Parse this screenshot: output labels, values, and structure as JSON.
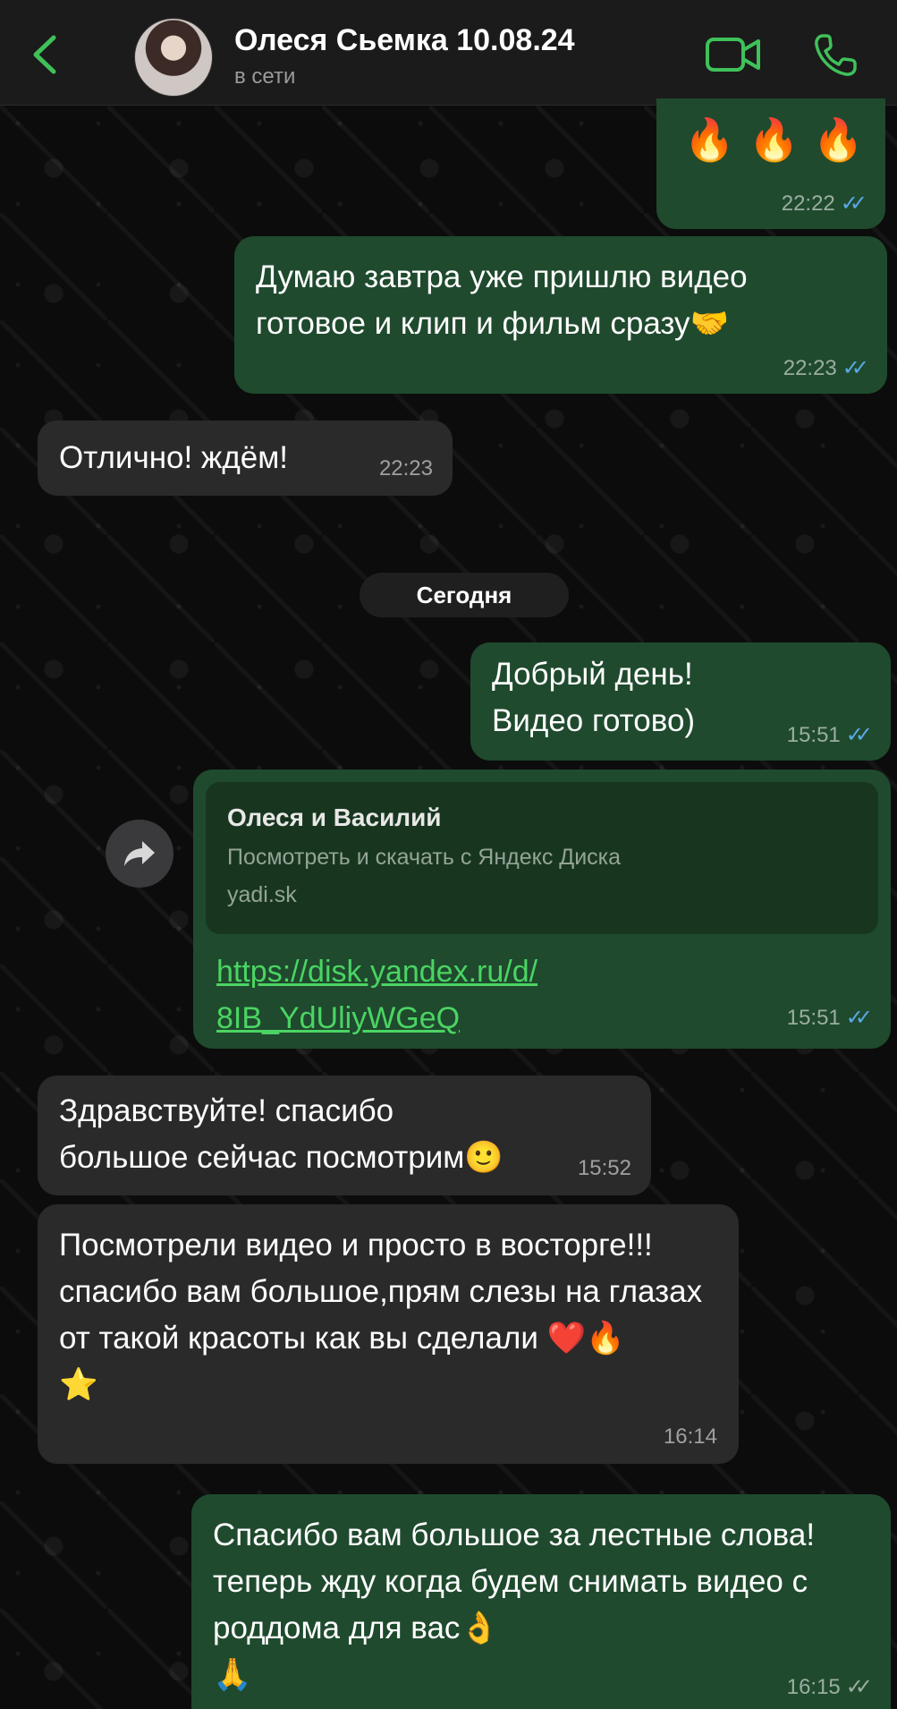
{
  "header": {
    "contact_name": "Олеся Сьемка 10.08.24",
    "status": "в сети",
    "accent": "#3fc15a"
  },
  "date_separator": "Сегодня",
  "messages": [
    {
      "dir": "out",
      "text": "🔥 🔥 🔥",
      "time": "22:22",
      "ticks": "read"
    },
    {
      "dir": "out",
      "text": "Думаю завтра уже пришлю видео готовое и клип и фильм сразу🤝",
      "time": "22:23",
      "ticks": "read"
    },
    {
      "dir": "in",
      "text": "Отлично! ждём!",
      "time": "22:23"
    },
    {
      "dir": "out",
      "text": "Добрый день!\nВидео готово)",
      "time": "15:51",
      "ticks": "read"
    },
    {
      "dir": "out",
      "link_title": "Олеся и Василий",
      "link_desc": "Посмотреть и скачать с Яндекс Диска",
      "link_domain": "yadi.sk",
      "link_url": "https://disk.yandex.ru/d/\n8IB_YdUliyWGeQ",
      "time": "15:51",
      "ticks": "read"
    },
    {
      "dir": "in",
      "text": "Здравствуйте! спасибо большое сейчас посмотрим🙂",
      "time": "15:52"
    },
    {
      "dir": "in",
      "text": "Посмотрели видео и просто в восторге!!!спасибо вам большое,прям слезы на глазах от такой красоты как вы сделали ❤️🔥\n⭐",
      "time": "16:14"
    },
    {
      "dir": "out",
      "text": "Спасибо вам большое за лестные слова!теперь жду когда будем снимать видео с роддома для вас👌\n🙏",
      "time": "16:15",
      "ticks": "delivered"
    }
  ],
  "colors": {
    "outgoing_bubble": "#1f4a2e",
    "incoming_bubble": "#2a2a2b",
    "read_ticks": "#5aa9e6",
    "link": "#4bd463"
  }
}
